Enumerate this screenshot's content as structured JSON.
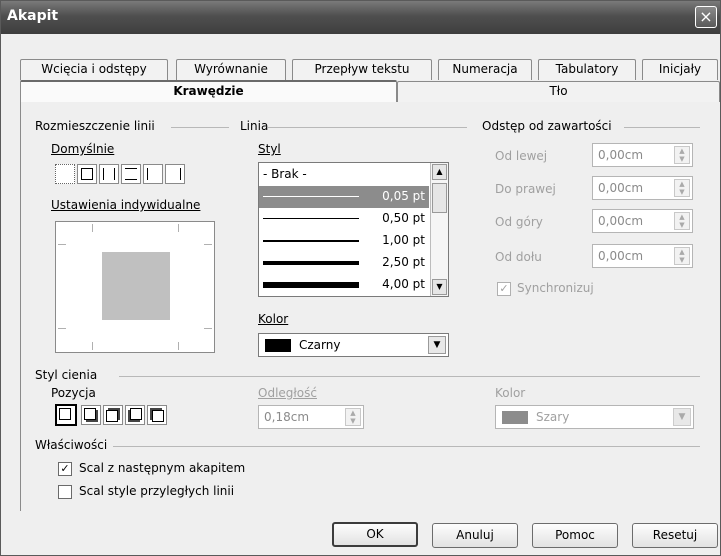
{
  "window": {
    "title": "Akapit",
    "close_icon": "×"
  },
  "tabs_row1": [
    "Wcięcia i odstępy",
    "Wyrównanie",
    "Przepływ tekstu",
    "Numeracja",
    "Tabulatory",
    "Inicjały"
  ],
  "tabs_row2": [
    "Krawędzie",
    "Tło"
  ],
  "line_arrangement": {
    "title": "Rozmieszczenie linii",
    "default_label": "Domyślnie",
    "custom_label": "Ustawienia indywidualne"
  },
  "line": {
    "title": "Linia",
    "style_label": "Styl",
    "styles": [
      {
        "label": "- Brak -"
      },
      {
        "label": "0,05 pt"
      },
      {
        "label": "0,50 pt"
      },
      {
        "label": "1,00 pt"
      },
      {
        "label": "2,50 pt"
      },
      {
        "label": "4,00 pt"
      }
    ],
    "selected_style": "0,05 pt",
    "color_label": "Kolor",
    "color_value": "Czarny",
    "color_hex": "#000000"
  },
  "spacing": {
    "title": "Odstęp od zawartości",
    "left_label": "Od lewej",
    "left_value": "0,00cm",
    "right_label": "Do prawej",
    "right_value": "0,00cm",
    "top_label": "Od góry",
    "top_value": "0,00cm",
    "bottom_label": "Od dołu",
    "bottom_value": "0,00cm",
    "sync_label": "Synchronizuj",
    "sync_checked": true
  },
  "shadow": {
    "title": "Styl cienia",
    "position_label": "Pozycja",
    "distance_label": "Odległość",
    "distance_value": "0,18cm",
    "color_label": "Kolor",
    "color_value": "Szary",
    "color_hex": "#8c8c8c"
  },
  "properties": {
    "title": "Właściwości",
    "merge_next_label": "Scal z następnym akapitem",
    "merge_next_checked": true,
    "merge_adjacent_label": "Scal style przyległych linii",
    "merge_adjacent_checked": false
  },
  "buttons": {
    "ok": "OK",
    "cancel": "Anuluj",
    "help": "Pomoc",
    "reset": "Resetuj"
  }
}
